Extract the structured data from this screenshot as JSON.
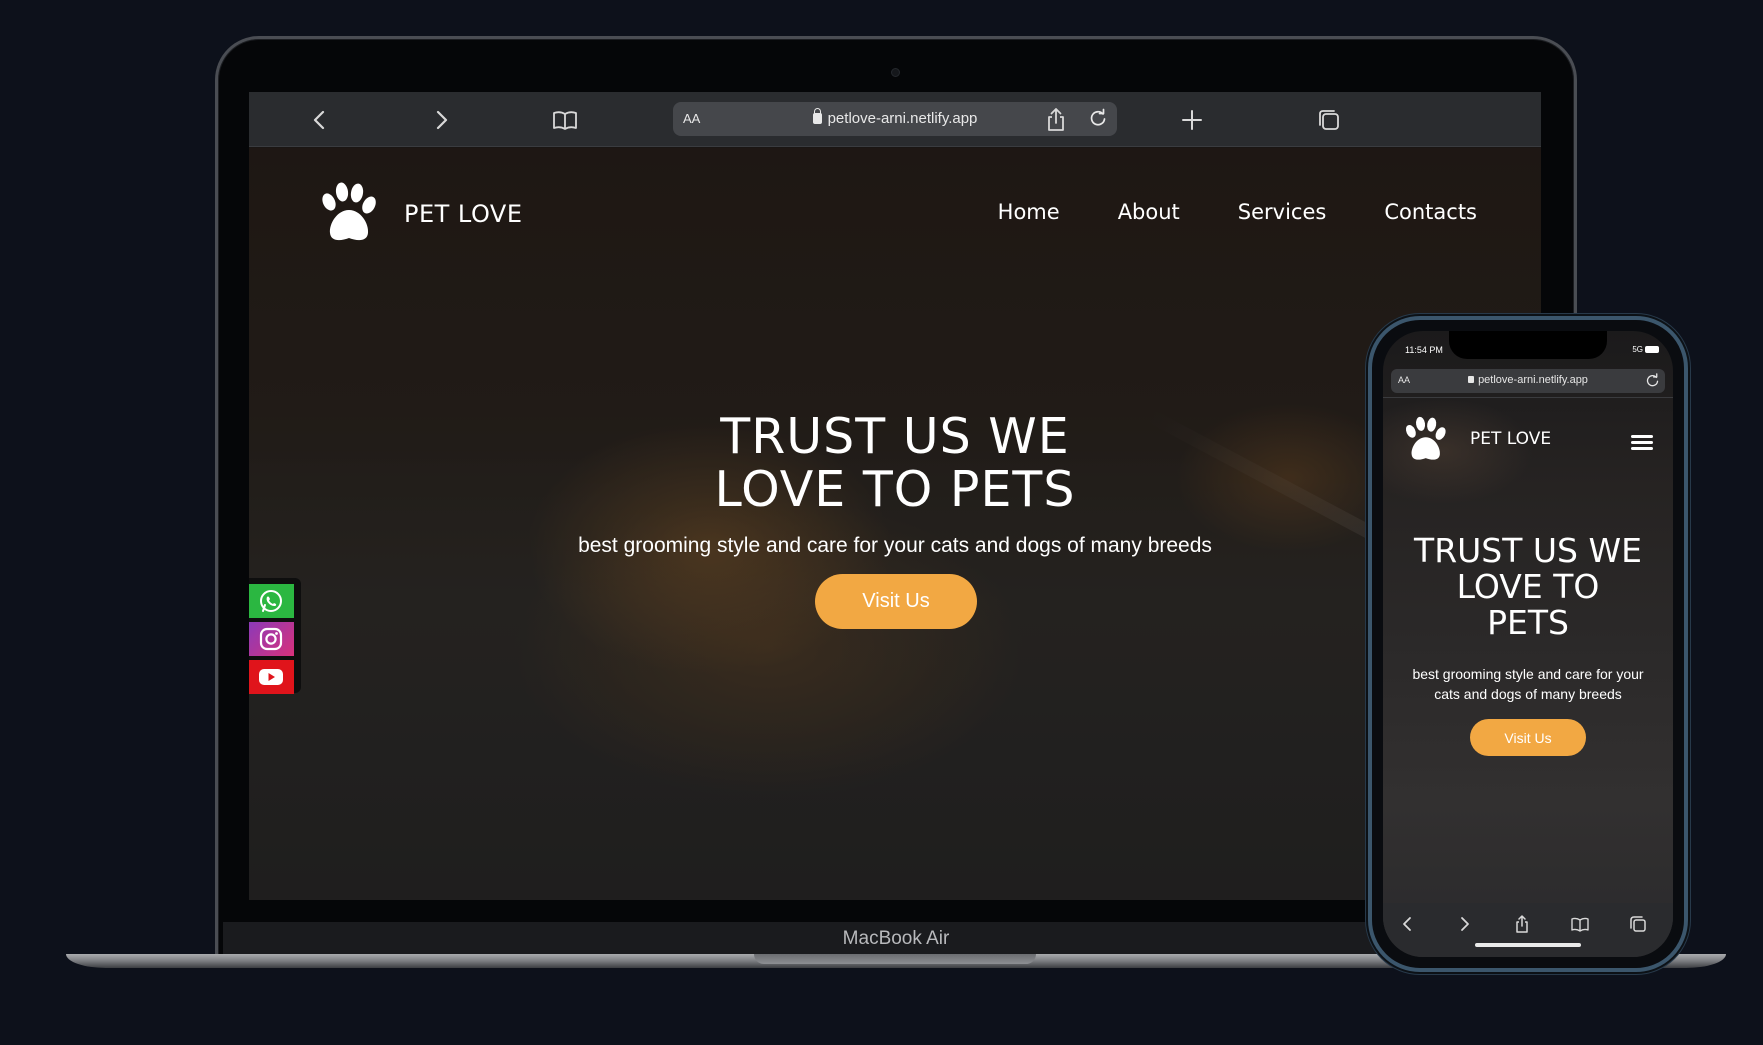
{
  "laptop": {
    "model_label": "MacBook Air",
    "browser": {
      "text_size_label": "AA",
      "url": "petlove-arni.netlify.app"
    },
    "site": {
      "brand": "PET LOVE",
      "nav": [
        "Home",
        "About",
        "Services",
        "Contacts"
      ],
      "hero_title_line1": "TRUST US WE",
      "hero_title_line2": "LOVE TO PETS",
      "hero_subtitle": "best grooming style and care for your cats and dogs of many breeds",
      "cta_label": "Visit Us",
      "social": [
        "whatsapp",
        "instagram",
        "youtube"
      ]
    }
  },
  "phone": {
    "status_time": "11:54 PM",
    "status_network": "5G",
    "browser": {
      "text_size_label": "AA",
      "url": "petlove-arni.netlify.app"
    },
    "site": {
      "brand": "PET LOVE",
      "hero_title_line1": "TRUST US WE",
      "hero_title_line2": "LOVE TO",
      "hero_title_line3": "PETS",
      "hero_subtitle": "best grooming style and care for your cats and dogs of many breeds",
      "cta_label": "Visit Us"
    }
  },
  "colors": {
    "background": "#0d111b",
    "accent_button": "#f2a843",
    "browser_bar": "#2a2c2f"
  }
}
